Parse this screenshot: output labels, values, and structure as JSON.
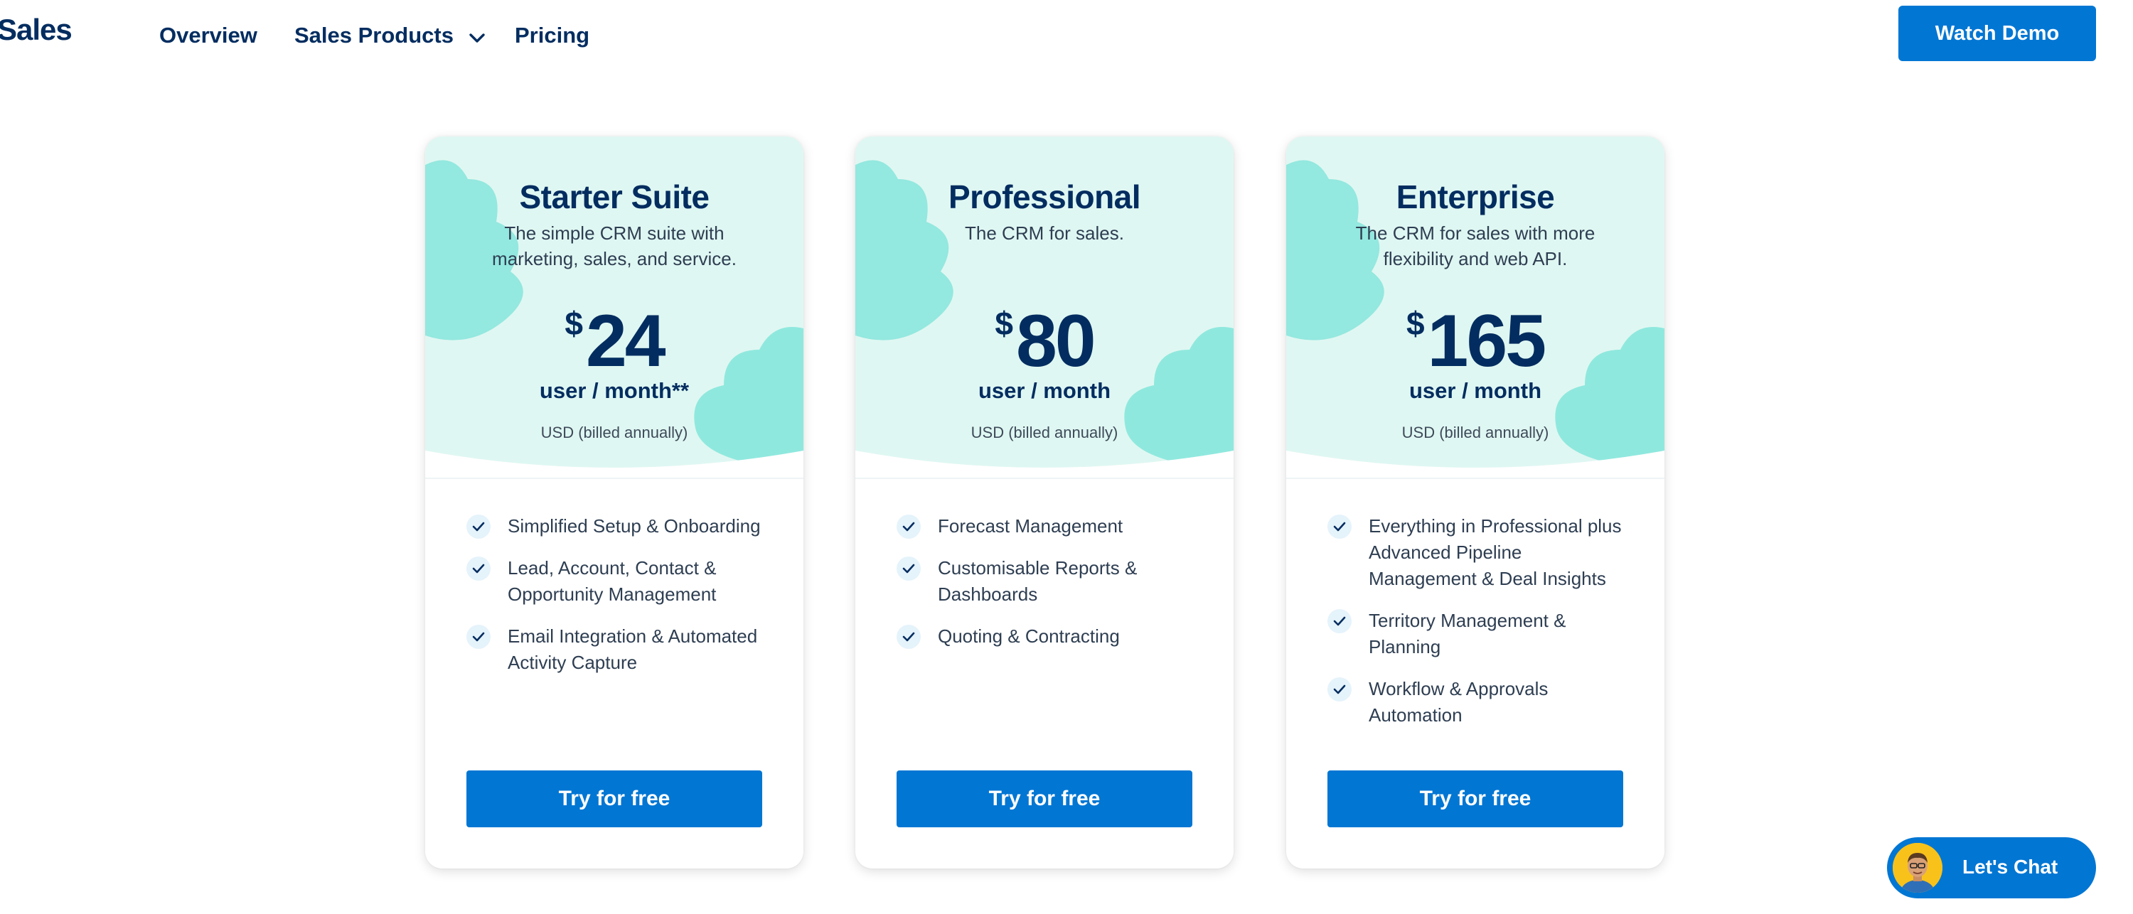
{
  "header": {
    "brand": "Sales",
    "nav": {
      "overview": "Overview",
      "sales_products": "Sales Products",
      "pricing": "Pricing"
    },
    "watch_demo": "Watch Demo"
  },
  "plans": [
    {
      "title": "Starter Suite",
      "subtitle": "The simple CRM suite with marketing, sales, and service.",
      "currency": "$",
      "price": "24",
      "unit": "user / month**",
      "billing": "USD (billed annually)",
      "features": [
        "Simplified Setup & Onboarding",
        "Lead, Account, Contact & Opportunity Management",
        "Email Integration & Automated Activity Capture"
      ],
      "cta": "Try for free"
    },
    {
      "title": "Professional",
      "subtitle": "The CRM for sales.",
      "currency": "$",
      "price": "80",
      "unit": "user / month",
      "billing": "USD (billed annually)",
      "features": [
        "Forecast Management",
        "Customisable Reports & Dashboards",
        "Quoting & Contracting"
      ],
      "cta": "Try for free"
    },
    {
      "title": "Enterprise",
      "subtitle": "The CRM for sales with more flexibility and web API.",
      "currency": "$",
      "price": "165",
      "unit": "user / month",
      "billing": "USD (billed annually)",
      "features": [
        "Everything in Professional plus Advanced Pipeline Management & Deal Insights",
        "Territory Management & Planning",
        "Workflow & Approvals Automation"
      ],
      "cta": "Try for free"
    }
  ],
  "chat": {
    "label": "Let's Chat"
  },
  "colors": {
    "brand_blue": "#0176d3",
    "navy_text": "#032d60",
    "mint_background": "#dff7f2",
    "mint_cloud": "#7ae3d8"
  },
  "icons": {
    "nav_dropdown": "chevron-down-icon",
    "feature_check": "check-icon",
    "chat_avatar": "avatar"
  }
}
